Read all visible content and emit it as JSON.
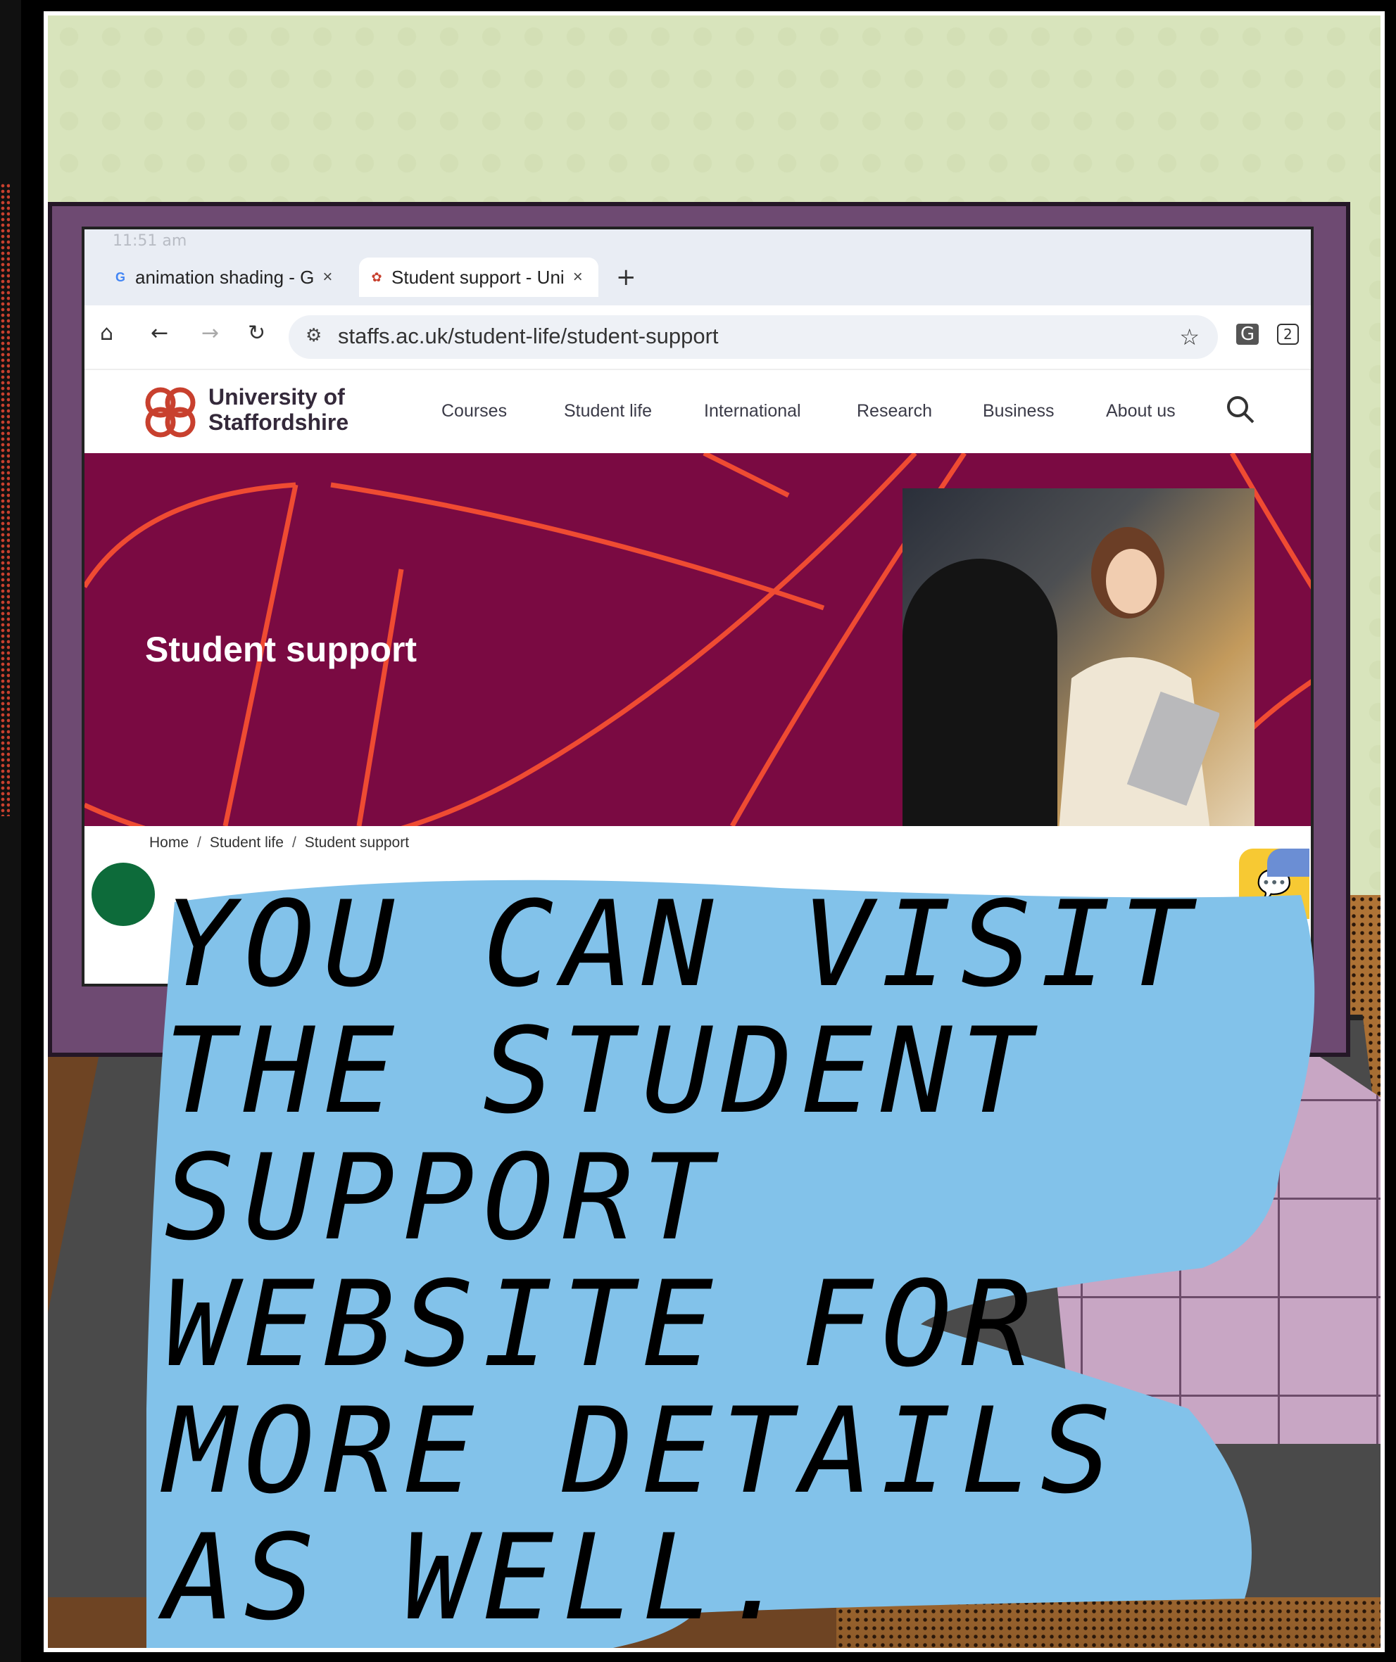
{
  "status_bar": {
    "time": "11:51 am"
  },
  "browser": {
    "tabs": [
      {
        "label": "animation shading - G",
        "favicon": "google-g-icon",
        "close": "×"
      },
      {
        "label": "Student support - Uni",
        "favicon": "staffordshire-logo-icon",
        "close": "×"
      }
    ],
    "new_tab": "+",
    "url": "staffs.ac.uk/student-life/student-support",
    "tab_count": "2"
  },
  "site": {
    "logo_line1": "University of",
    "logo_line2": "Staffordshire",
    "nav": [
      "Courses",
      "Student life",
      "International",
      "Research",
      "Business",
      "About us"
    ],
    "hero_title": "Student support",
    "breadcrumb": [
      "Home",
      "Student life",
      "Student support"
    ],
    "colors": {
      "hero": "#7a0a42",
      "hero_lines": "#ef4b32",
      "logo": "#c8402e"
    }
  },
  "caption": {
    "text": "YOU CAN VISIT\nTHE STUDENT\nSUPPORT\nWEBSITE FOR\nMORE DETAILS\nAS WELL.",
    "bubble_color": "#82c2ea"
  }
}
